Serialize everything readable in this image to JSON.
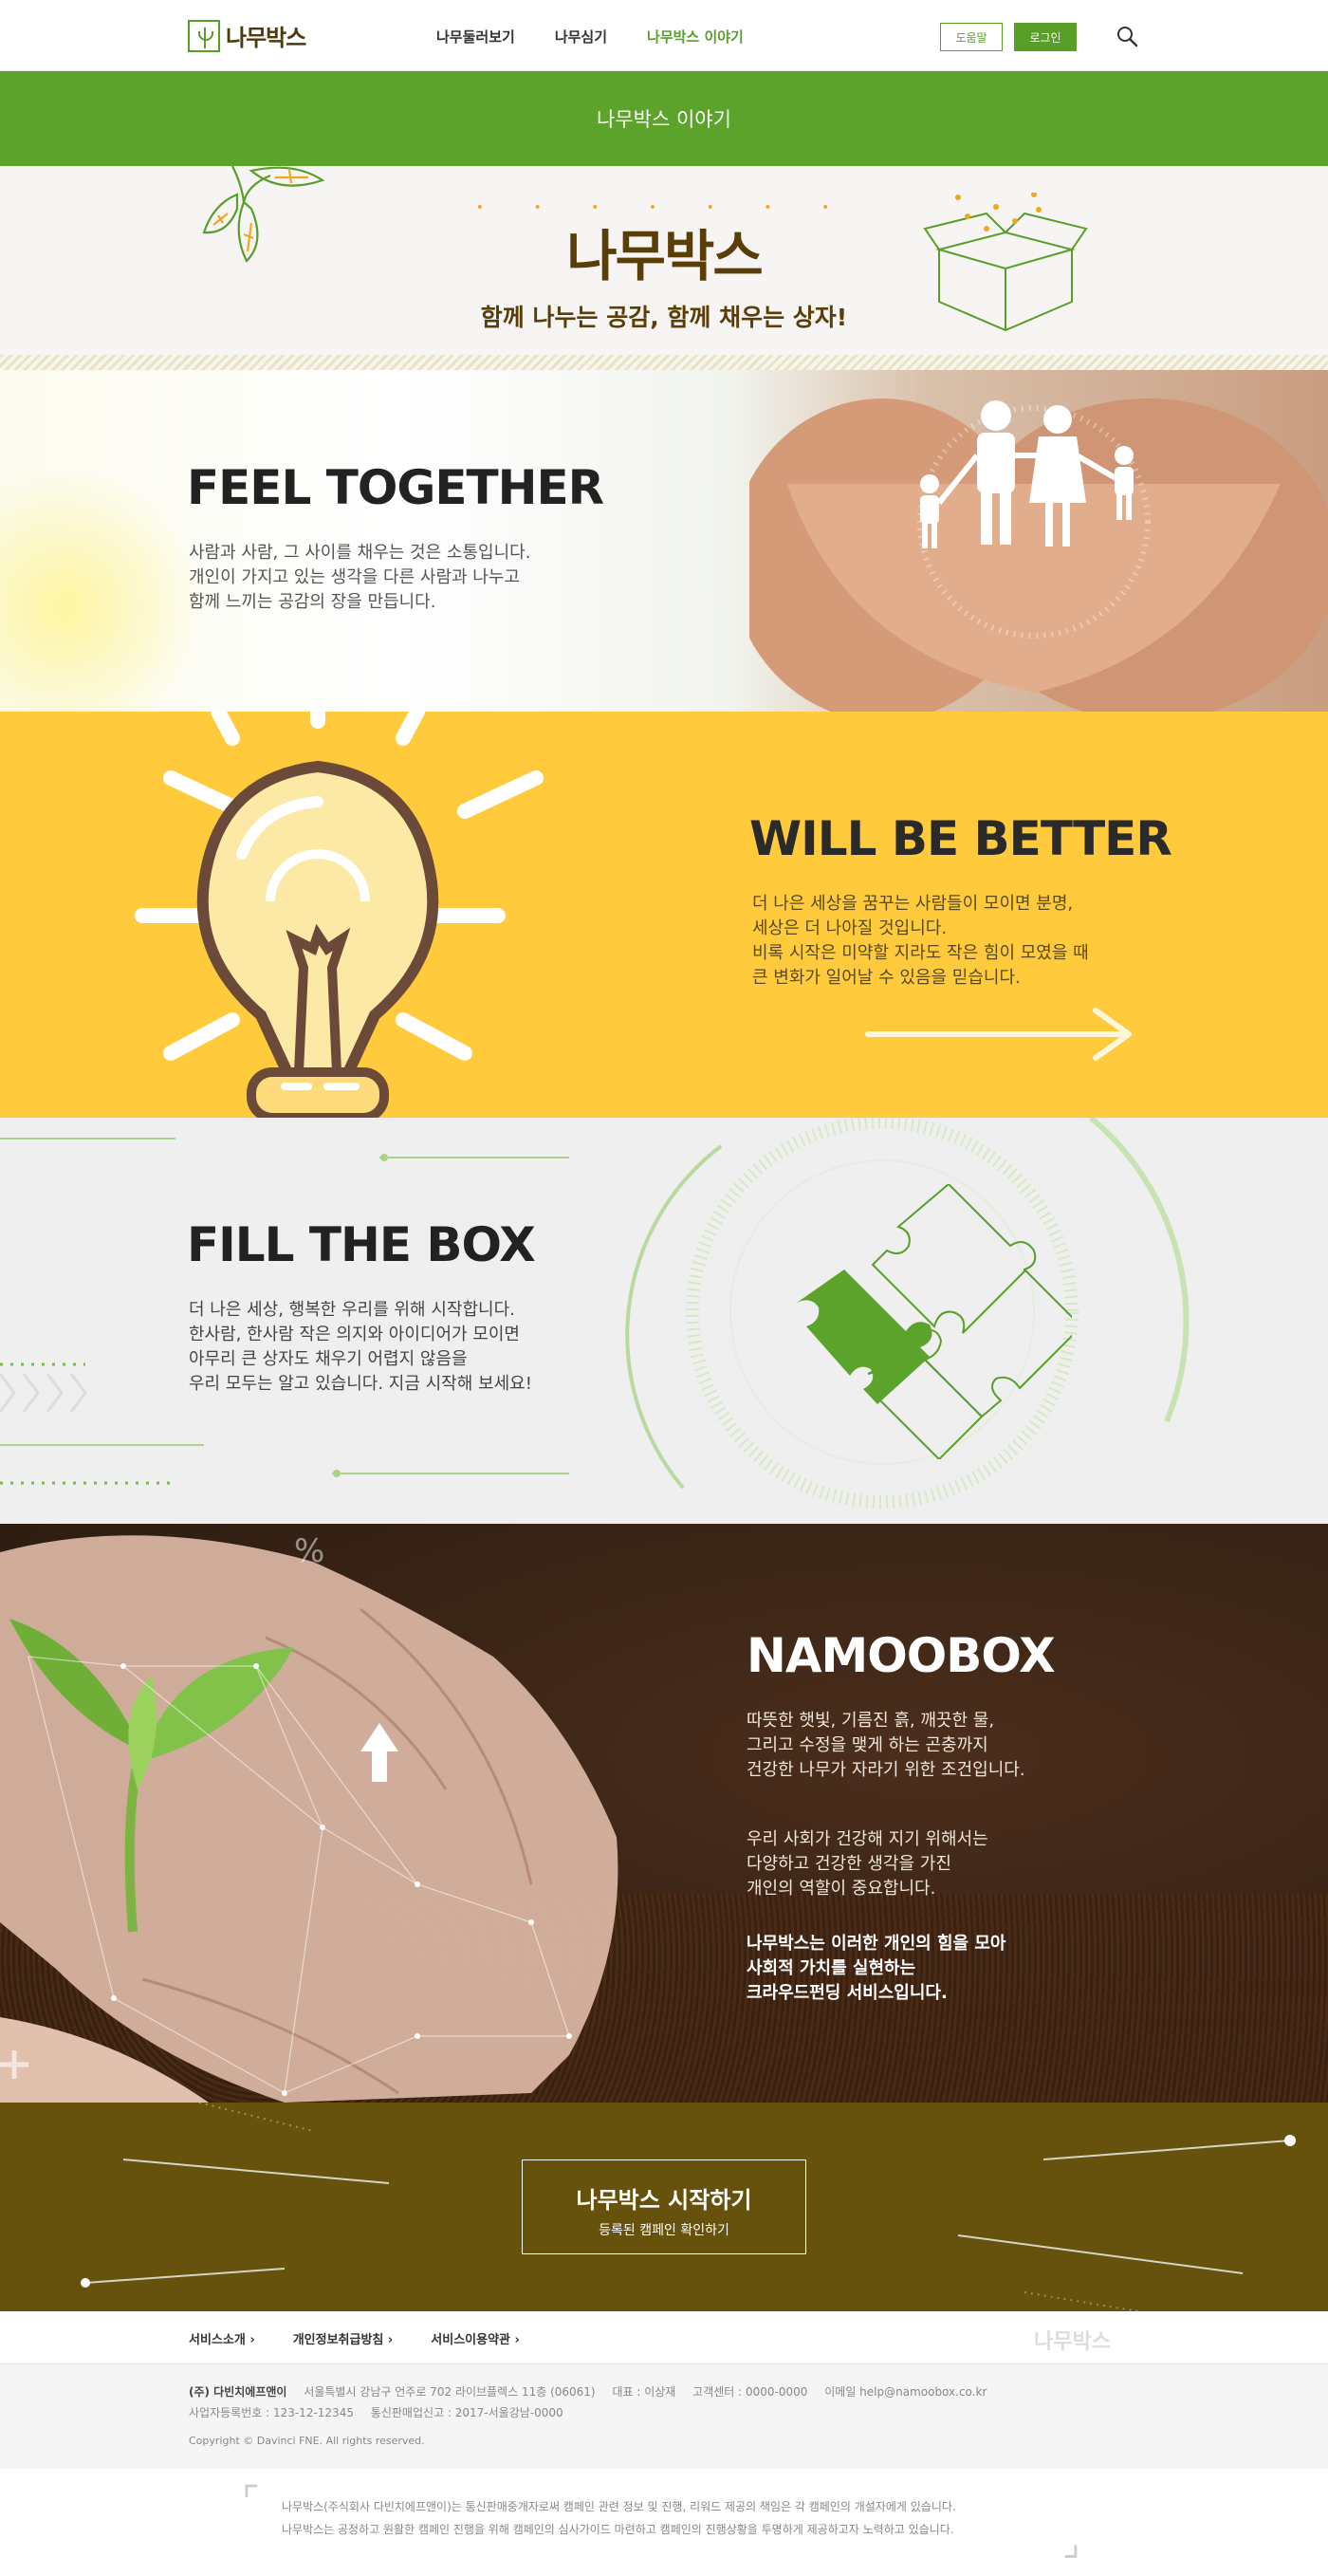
{
  "header": {
    "logo": "나무박스",
    "nav": [
      {
        "label": "나무둘러보기",
        "active": false
      },
      {
        "label": "나무심기",
        "active": false
      },
      {
        "label": "나무박스 이야기",
        "active": true
      }
    ],
    "help_label": "도움말",
    "login_label": "로그인",
    "search_icon": "search-icon"
  },
  "banner": {
    "title": "나무박스 이야기"
  },
  "intro": {
    "title": "나무박스",
    "subtitle": "함께 나누는 공감, 함께 채우는 상자!"
  },
  "sections": {
    "feel": {
      "title": "FEEL TOGETHER",
      "lines": [
        "사람과 사람, 그 사이를 채우는 것은 소통입니다.",
        "개인이 가지고 있는 생각을 다른 사람과 나누고",
        "함께 느끼는 공감의 장을 만듭니다."
      ]
    },
    "better": {
      "title": "WILL BE BETTER",
      "lines": [
        "더 나은 세상을 꿈꾸는 사람들이 모이면 분명,",
        "세상은 더 나아질 것입니다.",
        "비록 시작은 미약할 지라도 작은 힘이 모였을 때",
        "큰 변화가 일어날 수 있음을 믿습니다."
      ]
    },
    "fill": {
      "title": "FILL THE BOX",
      "lines": [
        "더 나은 세상, 행복한 우리를 위해 시작합니다.",
        "한사람, 한사람 작은 의지와 아이디어가 모이면",
        "아무리 큰 상자도 채우기 어렵지 않음을",
        "우리 모두는 알고 있습니다. 지금 시작해 보세요!"
      ]
    },
    "namoobox": {
      "title": "NAMOOBOX",
      "para1": [
        "따뜻한 햇빛, 기름진 흙, 깨끗한 물,",
        "그리고 수정을 맺게 하는 곤충까지",
        "건강한 나무가 자라기 위한 조건입니다."
      ],
      "para2": [
        "우리 사회가 건강해 지기 위해서는",
        "다양하고 건강한 생각을 가진",
        "개인의 역할이 중요합니다."
      ],
      "para3": [
        "나무박스는 이러한 개인의 힘을 모아",
        "사회적 가치를 실현하는",
        "크라우드펀딩 서비스입니다."
      ]
    }
  },
  "cta": {
    "title": "나무박스 시작하기",
    "subtitle": "등록된 캠페인 확인하기"
  },
  "footer": {
    "links": [
      "서비스소개",
      "개인정보취급방침",
      "서비스이용약관"
    ],
    "logo": "나무박스",
    "company": "(주) 다빈치에프앤이",
    "address": "서울특별시 강남구 언주로 702 라이브플렉스 11층 (06061)",
    "ceo": "대표 : 이상재",
    "center": "고객센터 : 0000-0000",
    "email": "이메일 help@namoobox.co.kr",
    "biz_no": "사업자등록번호 : 123-12-12345",
    "mail_order": "통신판매업신고 : 2017-서울강남-0000",
    "copyright": "Copyright © Davinci FNE. All rights reserved.",
    "notice": [
      "나무박스(주식회사 다빈치에프앤이)는 통신판매중개자로써 캠페인 관련 정보 및 진행, 리워드 제공의 책임은 각 캠페인의 개설자에게 있습니다.",
      "나무박스는 공정하고 원활한 캠페인 진행을 위해 캠페인의 심사가이드 마련하고 캠페인의 진행상황을 투명하게 제공하고자 노력하고 있습니다."
    ]
  }
}
